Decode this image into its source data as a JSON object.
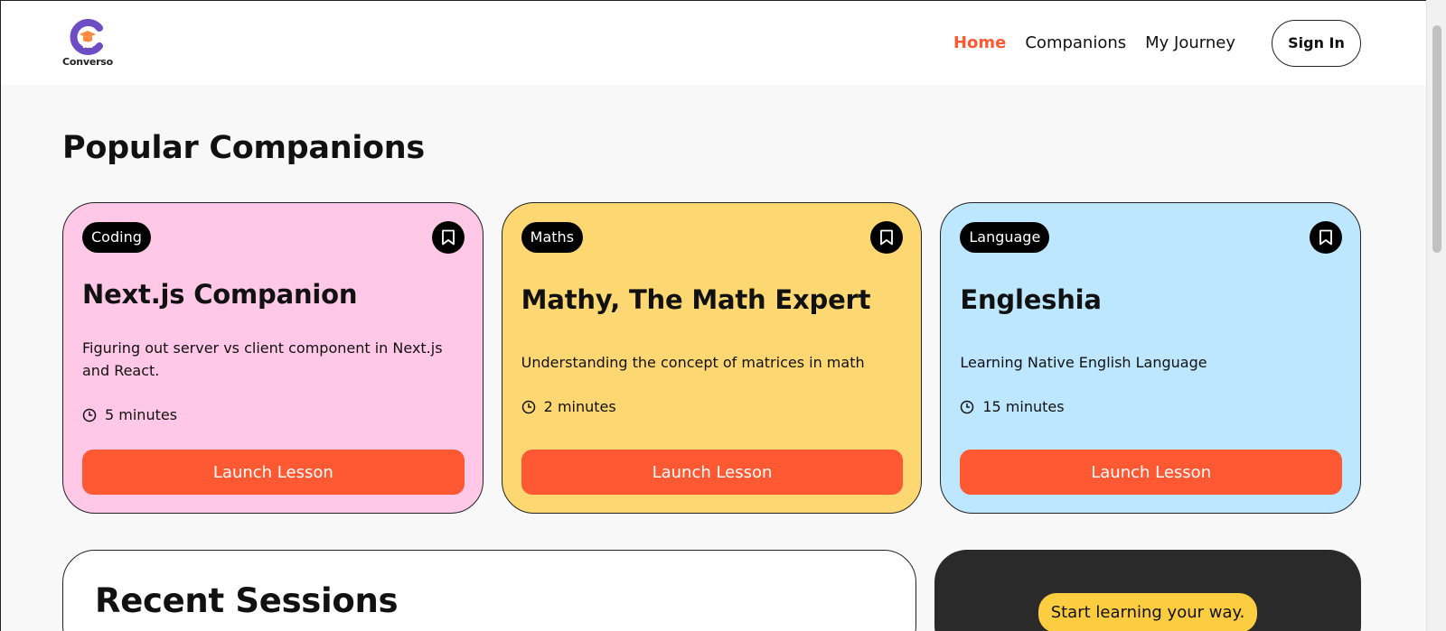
{
  "brand": {
    "name": "Converso",
    "logo_colors": {
      "primary": "#6d4cc4",
      "accent": "#fe8a3d"
    }
  },
  "nav": {
    "links": [
      {
        "label": "Home",
        "active": true
      },
      {
        "label": "Companions",
        "active": false
      },
      {
        "label": "My Journey",
        "active": false
      }
    ],
    "sign_in_label": "Sign In"
  },
  "popular": {
    "title": "Popular Companions",
    "cards": [
      {
        "subject": "Coding",
        "name": "Next.js Companion",
        "topic": "Figuring out server vs client component in Next.js and React.",
        "duration": "5 minutes",
        "button": "Launch Lesson",
        "color": "#fec8e6",
        "icon": "bookmark-icon"
      },
      {
        "subject": "Maths",
        "name": "Mathy, The Math Expert",
        "topic": "Understanding the concept of matrices in math",
        "duration": "2 minutes",
        "button": "Launch Lesson",
        "color": "#fdd872",
        "icon": "bookmark-icon"
      },
      {
        "subject": "Language",
        "name": "Engleshia",
        "topic": "Learning Native English Language",
        "duration": "15 minutes",
        "button": "Launch Lesson",
        "color": "#bde7ff",
        "icon": "bookmark-icon"
      }
    ]
  },
  "recent": {
    "title": "Recent Sessions"
  },
  "cta": {
    "badge": "Start learning your way."
  },
  "colors": {
    "primary": "#fe5933",
    "dark": "#2a2a2a",
    "badge": "#fccc41"
  }
}
